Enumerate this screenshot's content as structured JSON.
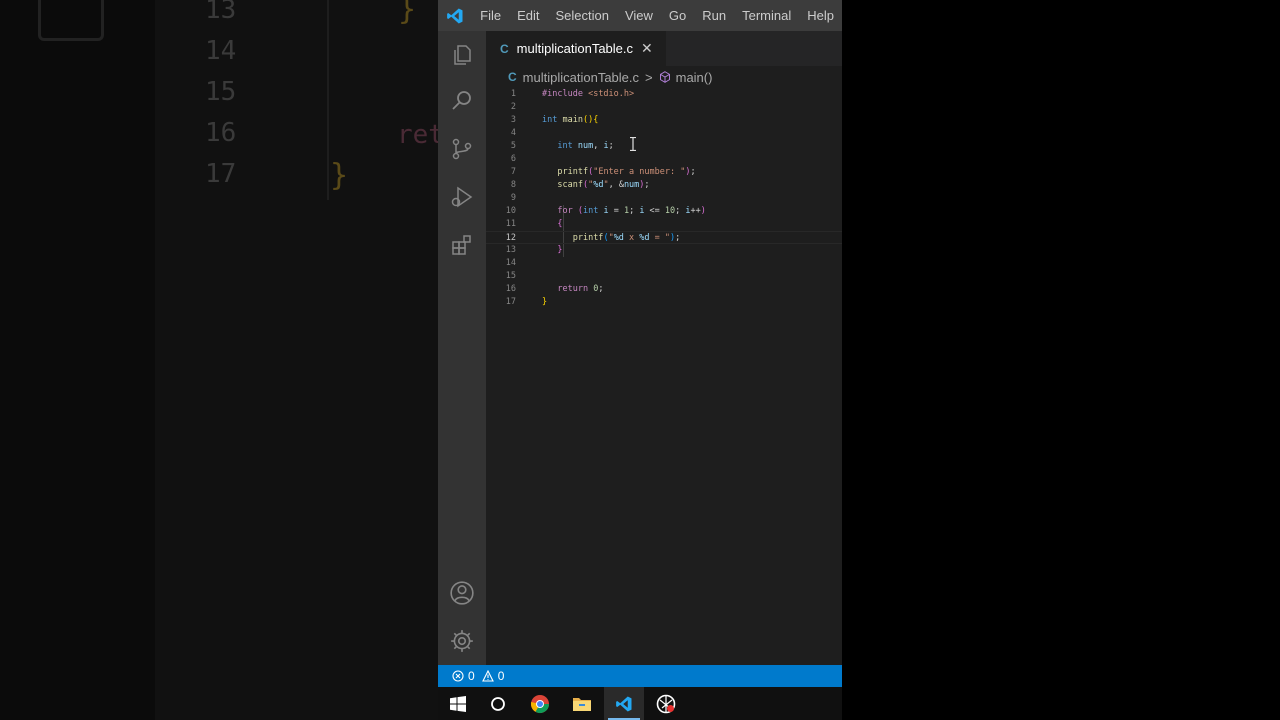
{
  "menu": [
    "File",
    "Edit",
    "Selection",
    "View",
    "Go",
    "Run",
    "Terminal",
    "Help"
  ],
  "tab": {
    "icon": "C",
    "label": "multiplicationTable.c",
    "close": "✕"
  },
  "breadcrumb": {
    "icon": "C",
    "file": "multiplicationTable.c",
    "sep": ">",
    "symbol": "main()"
  },
  "background_text": {
    "line_numbers": [
      "13",
      "14",
      "15",
      "16",
      "17"
    ],
    "brace_top": "}",
    "brace_bottom": "}",
    "return_fragment": "ret"
  },
  "editor": {
    "line_numbers": [
      "1",
      "2",
      "3",
      "4",
      "5",
      "6",
      "7",
      "8",
      "9",
      "10",
      "11",
      "12",
      "13",
      "14",
      "15",
      "16",
      "17"
    ],
    "active_line": 12
  },
  "status": {
    "errors": "0",
    "warnings": "0"
  },
  "activity_icons": [
    "explorer-icon",
    "search-icon",
    "source-control-icon",
    "run-debug-icon",
    "extensions-icon",
    "account-icon",
    "settings-gear-icon"
  ],
  "taskbar_icons": [
    "windows-start-icon",
    "cortana-search-icon",
    "chrome-icon",
    "file-explorer-icon",
    "vscode-icon",
    "screen-recorder-icon"
  ],
  "colors": {
    "accent": "#007acc",
    "editor_bg": "#1e1e1e",
    "titlebar": "#3c3c3c",
    "activitybar": "#333333"
  }
}
